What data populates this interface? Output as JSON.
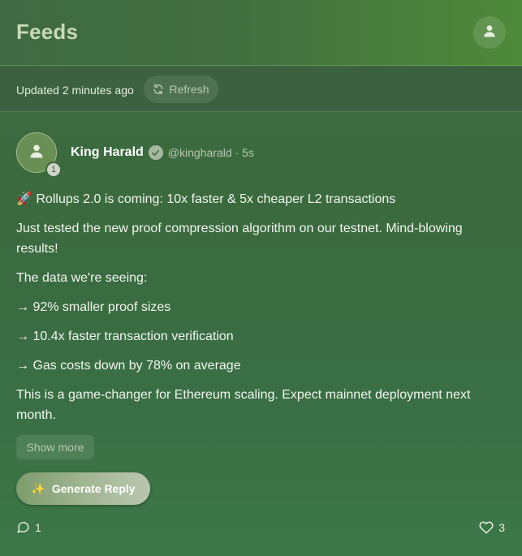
{
  "header": {
    "title": "Feeds",
    "profile_icon": "user-icon"
  },
  "update_bar": {
    "updated_text": "Updated 2 minutes ago",
    "refresh_label": "Refresh",
    "refresh_icon": "refresh-icon"
  },
  "post": {
    "author_name": "King Harald",
    "verified": true,
    "handle_time": "@kingharald · 5s",
    "avatar_badge": "1",
    "title_emoji": "🚀",
    "title": "Rollups 2.0 is coming: 10x faster & 5x cheaper L2 transactions",
    "paragraphs": [
      "Just tested the new proof compression algorithm on our testnet. Mind-blowing results!",
      "The data we're seeing:",
      "→ 92% smaller proof sizes",
      "→ 10.4x faster transaction verification",
      "→ Gas costs down by 78% on average",
      "This is a game-changer for Ethereum scaling. Expect mainnet deployment next month."
    ],
    "show_more_label": "Show more",
    "generate_reply_emoji": "✨",
    "generate_reply_label": "Generate Reply",
    "reply_count": "1",
    "like_count": "3"
  },
  "colors": {
    "background": "#3b6a3f",
    "header_accent": "#4f8a3a",
    "title_text": "#c9d9b4"
  }
}
